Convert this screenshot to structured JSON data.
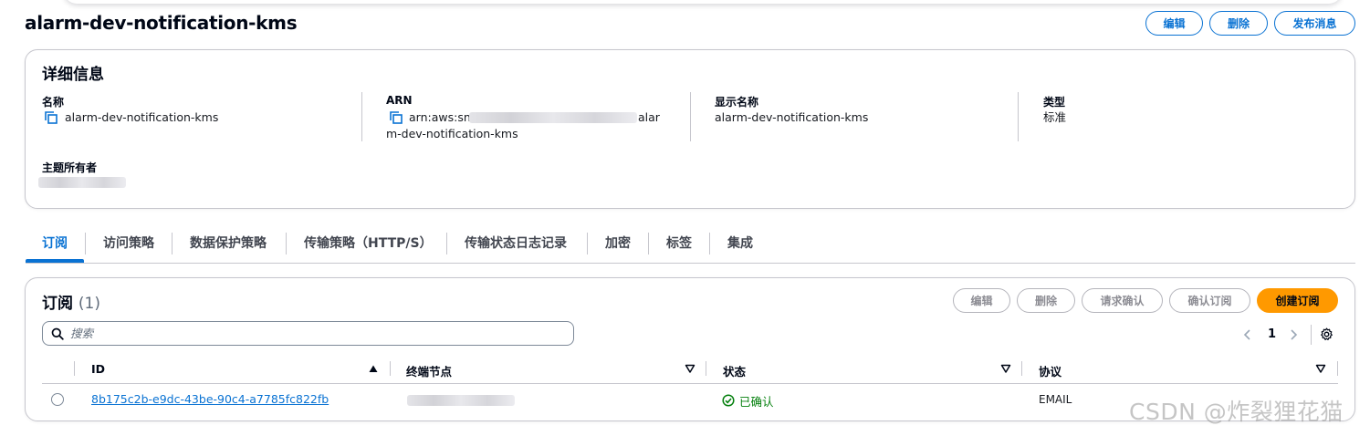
{
  "page": {
    "title": "alarm-dev-notification-kms",
    "actions": {
      "edit": "编辑",
      "delete": "删除",
      "publish": "发布消息"
    }
  },
  "details": {
    "title": "详细信息",
    "name_label": "名称",
    "name_value": "alarm-dev-notification-kms",
    "arn_label": "ARN",
    "arn_line1_start": "arn:aws:sns",
    "arn_line1_end": "alar",
    "arn_line2": "m-dev-notification-kms",
    "display_name_label": "显示名称",
    "display_name_value": "alarm-dev-notification-kms",
    "type_label": "类型",
    "type_value": "标准",
    "owner_label": "主题所有者"
  },
  "tabs": [
    {
      "label": "订阅"
    },
    {
      "label": "访问策略"
    },
    {
      "label": "数据保护策略"
    },
    {
      "label": "传输策略（HTTP/S）"
    },
    {
      "label": "传输状态日志记录"
    },
    {
      "label": "加密"
    },
    {
      "label": "标签"
    },
    {
      "label": "集成"
    }
  ],
  "subscriptions": {
    "title": "订阅",
    "count": "(1)",
    "actions": {
      "edit": "编辑",
      "delete": "删除",
      "request_confirm": "请求确认",
      "confirm": "确认订阅",
      "create": "创建订阅"
    },
    "search_placeholder": "搜索",
    "page_number": "1",
    "columns": {
      "id": "ID",
      "endpoint": "终端节点",
      "status": "状态",
      "protocol": "协议"
    },
    "rows": [
      {
        "id": "8b175c2b-e9dc-43be-90c4-a7785fc822fb",
        "status": "已确认",
        "protocol": "EMAIL"
      }
    ]
  },
  "watermark": "CSDN @炸裂狸花猫",
  "colors": {
    "accent": "#0972d3",
    "primary": "#ff9900",
    "success": "#037f0c",
    "border": "#c6c6cd"
  }
}
